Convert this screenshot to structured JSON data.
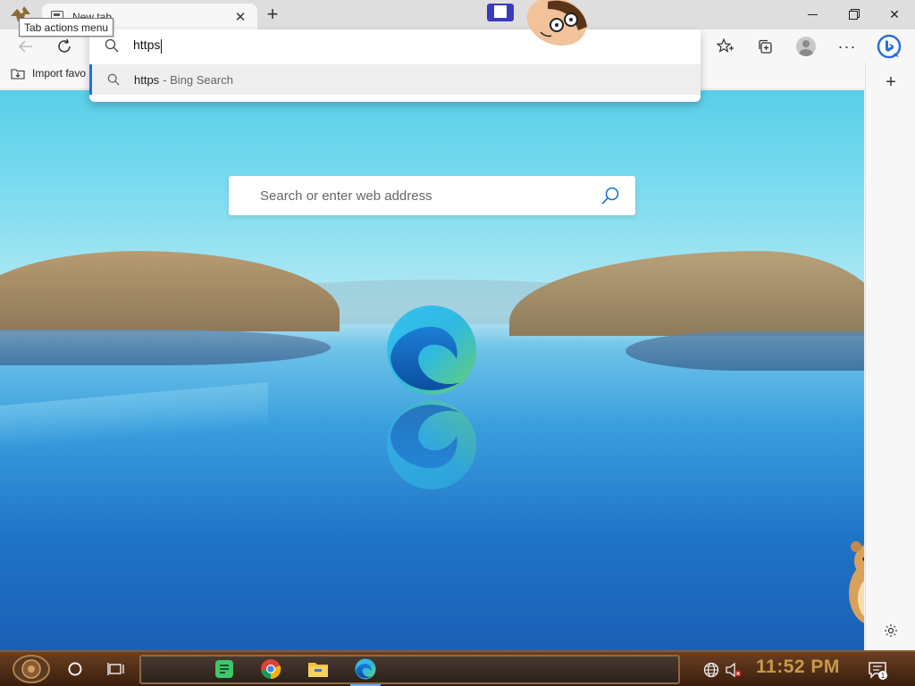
{
  "window": {
    "tab_title": "New tab",
    "tooltip": "Tab actions menu"
  },
  "icons": {
    "back": "arrow-left-icon",
    "refresh": "refresh-icon",
    "favorites": "star-icon",
    "collections": "collections-icon",
    "profile": "avatar-icon",
    "more": "more-icon",
    "bing": "bing-chat-icon",
    "sidebar_add": "plus-icon",
    "sidebar_settings": "gear-icon"
  },
  "address": {
    "typed_text": "https"
  },
  "suggestions": [
    {
      "query": "https",
      "source": "- Bing Search"
    }
  ],
  "favorites_bar": {
    "import_label": "Import favo"
  },
  "newtab": {
    "search_placeholder": "Search or enter web address"
  },
  "taskbar": {
    "time": "11:52 PM",
    "notification_count": "1"
  },
  "colors": {
    "accent": "#1a73e8",
    "edge_blue": "#0c59a4",
    "edge_green": "#4fc35b",
    "clock": "#c89a4a"
  }
}
